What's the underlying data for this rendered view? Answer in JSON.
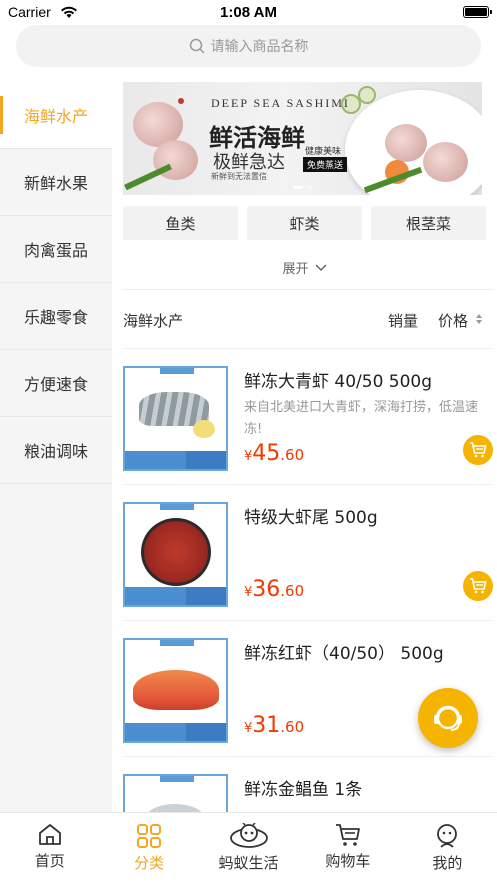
{
  "status_bar": {
    "carrier": "Carrier",
    "time": "1:08 AM"
  },
  "search": {
    "placeholder": "请输入商品名称",
    "icon": "search-icon"
  },
  "sidebar": {
    "items": [
      {
        "label": "海鲜水产",
        "active": true
      },
      {
        "label": "新鲜水果",
        "active": false
      },
      {
        "label": "肉禽蛋品",
        "active": false
      },
      {
        "label": "乐趣零食",
        "active": false
      },
      {
        "label": "方便速食",
        "active": false
      },
      {
        "label": "粮油调味",
        "active": false
      }
    ]
  },
  "banner": {
    "en_title": "DEEP SEA SASHIMI",
    "title": "鲜活海鲜",
    "subtitle": "极鲜急达",
    "tag1": "健康美味",
    "tag2": "免费蒸送",
    "footer": "新鲜到无法置信"
  },
  "subcategories": [
    "鱼类",
    "虾类",
    "根茎菜"
  ],
  "expand_label": "展开",
  "sort_bar": {
    "category": "海鲜水产",
    "sales": "销量",
    "price": "价格"
  },
  "products": [
    {
      "name": "鲜冻大青虾 40/50 500g",
      "desc": "来自北美进口大青虾，深海打捞，低温速冻!",
      "currency": "¥",
      "price_int": "45",
      "price_dec": ".60"
    },
    {
      "name": "特级大虾尾 500g",
      "desc": "",
      "currency": "¥",
      "price_int": "36",
      "price_dec": ".60"
    },
    {
      "name": "鲜冻红虾（40/50） 500g",
      "desc": "",
      "currency": "¥",
      "price_int": "31",
      "price_dec": ".60"
    },
    {
      "name": "鲜冻金鲳鱼 1条",
      "desc": "",
      "currency": "¥",
      "price_int": "",
      "price_dec": ""
    }
  ],
  "tabbar": {
    "items": [
      {
        "label": "首页",
        "icon": "home-icon",
        "active": false
      },
      {
        "label": "分类",
        "icon": "category-grid-icon",
        "active": true
      },
      {
        "label": "蚂蚁生活",
        "icon": "ant-life-icon",
        "active": false
      },
      {
        "label": "购物车",
        "icon": "shopping-cart-icon",
        "active": false
      },
      {
        "label": "我的",
        "icon": "profile-icon",
        "active": false
      }
    ]
  },
  "colors": {
    "accent": "#f5a623",
    "price": "#f03a00",
    "cart_button": "#f5b400"
  }
}
